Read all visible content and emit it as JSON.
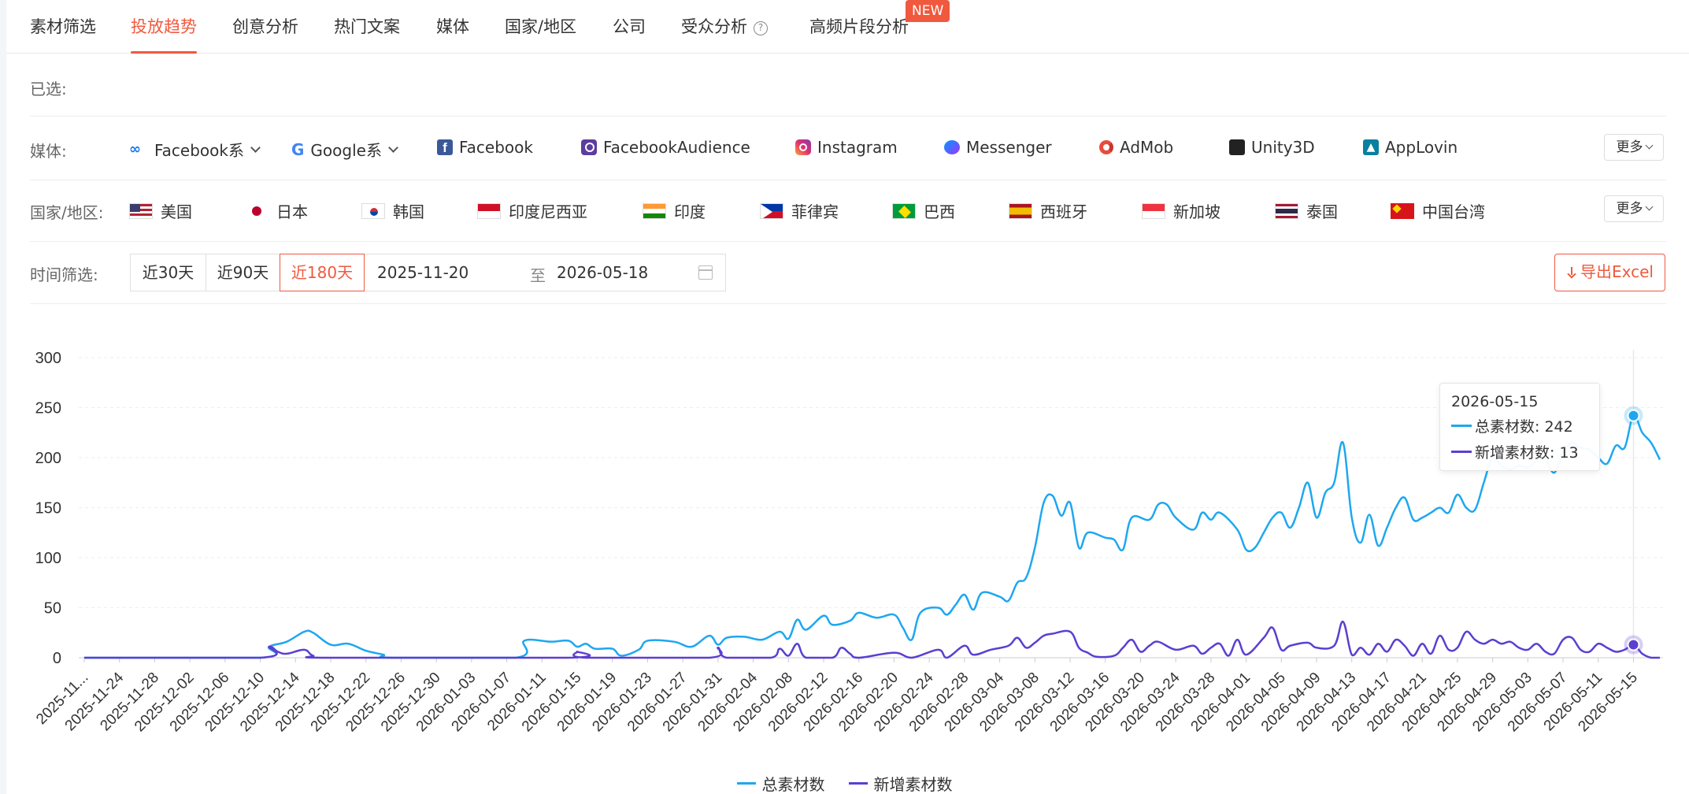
{
  "nav": {
    "tabs": [
      "素材筛选",
      "投放趋势",
      "创意分析",
      "热门文案",
      "媒体",
      "国家/地区",
      "公司",
      "受众分析",
      "高频片段分析"
    ],
    "active_tab": "投放趋势",
    "help_icon": "question-circle-icon",
    "new_badge": "NEW"
  },
  "selected_label": "已选:",
  "media": {
    "label": "媒体:",
    "items": [
      {
        "label": "Facebook系",
        "icon": "meta-icon",
        "dropdown": true
      },
      {
        "label": "Google系",
        "icon": "google-icon",
        "dropdown": true
      },
      {
        "label": "Facebook",
        "icon": "facebook-icon"
      },
      {
        "label": "FacebookAudience",
        "icon": "facebook-audience-icon"
      },
      {
        "label": "Instagram",
        "icon": "instagram-icon"
      },
      {
        "label": "Messenger",
        "icon": "messenger-icon"
      },
      {
        "label": "AdMob",
        "icon": "admob-icon"
      },
      {
        "label": "Unity3D",
        "icon": "unity-icon"
      },
      {
        "label": "AppLovin",
        "icon": "applovin-icon"
      }
    ],
    "more_label": "更多"
  },
  "region": {
    "label": "国家/地区:",
    "items": [
      {
        "label": "美国",
        "icon": "us-flag-icon"
      },
      {
        "label": "日本",
        "icon": "jp-flag-icon"
      },
      {
        "label": "韩国",
        "icon": "kr-flag-icon"
      },
      {
        "label": "印度尼西亚",
        "icon": "id-flag-icon"
      },
      {
        "label": "印度",
        "icon": "in-flag-icon"
      },
      {
        "label": "菲律宾",
        "icon": "ph-flag-icon"
      },
      {
        "label": "巴西",
        "icon": "br-flag-icon"
      },
      {
        "label": "西班牙",
        "icon": "es-flag-icon"
      },
      {
        "label": "新加坡",
        "icon": "sg-flag-icon"
      },
      {
        "label": "泰国",
        "icon": "th-flag-icon"
      },
      {
        "label": "中国台湾",
        "icon": "tw-flag-icon"
      }
    ],
    "more_label": "更多"
  },
  "time": {
    "label": "时间筛选:",
    "presets": [
      "近30天",
      "近90天",
      "近180天"
    ],
    "active_preset": "近180天",
    "start_date": "2025-11-20",
    "separator": "至",
    "end_date": "2026-05-18"
  },
  "export_label": "导出Excel",
  "colors": {
    "accent": "#f0593e",
    "total": "#1ea7f0",
    "new": "#5b3fd1"
  },
  "tooltip": {
    "date": "2026-05-15",
    "rows": [
      "总素材数: 242",
      "新增素材数: 13"
    ]
  },
  "chart_data": {
    "type": "line",
    "ylim": [
      0,
      300
    ],
    "yticks": [
      "0",
      "50",
      "100",
      "150",
      "200",
      "250",
      "300"
    ],
    "xticks": [
      "2025-11...",
      "2025-11-24",
      "2025-11-28",
      "2025-12-02",
      "2025-12-06",
      "2025-12-10",
      "2025-12-14",
      "2025-12-18",
      "2025-12-22",
      "2025-12-26",
      "2025-12-30",
      "2026-01-03",
      "2026-01-07",
      "2026-01-11",
      "2026-01-15",
      "2026-01-19",
      "2026-01-23",
      "2026-01-27",
      "2026-01-31",
      "2026-02-04",
      "2026-02-08",
      "2026-02-12",
      "2026-02-16",
      "2026-02-20",
      "2026-02-24",
      "2026-02-28",
      "2026-03-04",
      "2026-03-08",
      "2026-03-12",
      "2026-03-16",
      "2026-03-20",
      "2026-03-24",
      "2026-03-28",
      "2026-04-01",
      "2026-04-05",
      "2026-04-09",
      "2026-04-13",
      "2026-04-17",
      "2026-04-21",
      "2026-04-25",
      "2026-04-29",
      "2026-05-03",
      "2026-05-07",
      "2026-05-11",
      "2026-05-15"
    ],
    "x_start": "2025-11-20",
    "x_end": "2026-05-18",
    "grid": true,
    "legend_position": "bottom",
    "series": [
      {
        "name": "总素材数",
        "points": [
          [
            "2025-11-20",
            0
          ],
          [
            "2025-12-10",
            0
          ],
          [
            "2025-12-11",
            11
          ],
          [
            "2025-12-13",
            16
          ],
          [
            "2025-12-15",
            26
          ],
          [
            "2025-12-16",
            25
          ],
          [
            "2025-12-18",
            13
          ],
          [
            "2025-12-20",
            14
          ],
          [
            "2025-12-22",
            7
          ],
          [
            "2025-12-24",
            3
          ],
          [
            "2025-12-25",
            0
          ],
          [
            "2026-01-08",
            0
          ],
          [
            "2026-01-09",
            17
          ],
          [
            "2026-01-12",
            16
          ],
          [
            "2026-01-14",
            17
          ],
          [
            "2026-01-15",
            11
          ],
          [
            "2026-01-16",
            14
          ],
          [
            "2026-01-17",
            9
          ],
          [
            "2026-01-19",
            9
          ],
          [
            "2026-01-20",
            2
          ],
          [
            "2026-01-22",
            8
          ],
          [
            "2026-01-23",
            17
          ],
          [
            "2026-01-26",
            16
          ],
          [
            "2026-01-28",
            11
          ],
          [
            "2026-01-30",
            22
          ],
          [
            "2026-01-31",
            13
          ],
          [
            "2026-02-01",
            20
          ],
          [
            "2026-02-03",
            21
          ],
          [
            "2026-02-05",
            18
          ],
          [
            "2026-02-07",
            26
          ],
          [
            "2026-02-08",
            19
          ],
          [
            "2026-02-09",
            38
          ],
          [
            "2026-02-10",
            28
          ],
          [
            "2026-02-12",
            42
          ],
          [
            "2026-02-13",
            33
          ],
          [
            "2026-02-15",
            37
          ],
          [
            "2026-02-16",
            45
          ],
          [
            "2026-02-18",
            40
          ],
          [
            "2026-02-20",
            43
          ],
          [
            "2026-02-21",
            30
          ],
          [
            "2026-02-22",
            18
          ],
          [
            "2026-02-23",
            45
          ],
          [
            "2026-02-25",
            50
          ],
          [
            "2026-02-26",
            43
          ],
          [
            "2026-02-27",
            53
          ],
          [
            "2026-02-28",
            63
          ],
          [
            "2026-03-01",
            48
          ],
          [
            "2026-03-02",
            65
          ],
          [
            "2026-03-04",
            61
          ],
          [
            "2026-03-05",
            57
          ],
          [
            "2026-03-06",
            75
          ],
          [
            "2026-03-07",
            80
          ],
          [
            "2026-03-08",
            110
          ],
          [
            "2026-03-09",
            155
          ],
          [
            "2026-03-10",
            162
          ],
          [
            "2026-03-11",
            142
          ],
          [
            "2026-03-12",
            155
          ],
          [
            "2026-03-13",
            110
          ],
          [
            "2026-03-14",
            125
          ],
          [
            "2026-03-16",
            120
          ],
          [
            "2026-03-17",
            118
          ],
          [
            "2026-03-18",
            108
          ],
          [
            "2026-03-19",
            140
          ],
          [
            "2026-03-21",
            138
          ],
          [
            "2026-03-22",
            153
          ],
          [
            "2026-03-23",
            153
          ],
          [
            "2026-03-24",
            140
          ],
          [
            "2026-03-26",
            128
          ],
          [
            "2026-03-27",
            145
          ],
          [
            "2026-03-28",
            138
          ],
          [
            "2026-03-29",
            145
          ],
          [
            "2026-03-31",
            128
          ],
          [
            "2026-04-01",
            108
          ],
          [
            "2026-04-02",
            110
          ],
          [
            "2026-04-03",
            125
          ],
          [
            "2026-04-04",
            140
          ],
          [
            "2026-04-05",
            145
          ],
          [
            "2026-04-06",
            130
          ],
          [
            "2026-04-07",
            150
          ],
          [
            "2026-04-08",
            175
          ],
          [
            "2026-04-09",
            140
          ],
          [
            "2026-04-10",
            165
          ],
          [
            "2026-04-11",
            175
          ],
          [
            "2026-04-12",
            215
          ],
          [
            "2026-04-13",
            140
          ],
          [
            "2026-04-14",
            115
          ],
          [
            "2026-04-15",
            143
          ],
          [
            "2026-04-16",
            112
          ],
          [
            "2026-04-17",
            130
          ],
          [
            "2026-04-18",
            150
          ],
          [
            "2026-04-19",
            160
          ],
          [
            "2026-04-20",
            138
          ],
          [
            "2026-04-21",
            140
          ],
          [
            "2026-04-22",
            145
          ],
          [
            "2026-04-23",
            150
          ],
          [
            "2026-04-24",
            145
          ],
          [
            "2026-04-25",
            163
          ],
          [
            "2026-04-26",
            150
          ],
          [
            "2026-04-27",
            148
          ],
          [
            "2026-04-28",
            175
          ],
          [
            "2026-04-29",
            200
          ],
          [
            "2026-04-30",
            192
          ],
          [
            "2026-05-01",
            188
          ],
          [
            "2026-05-02",
            192
          ],
          [
            "2026-05-03",
            190
          ],
          [
            "2026-05-04",
            197
          ],
          [
            "2026-05-05",
            198
          ],
          [
            "2026-05-06",
            185
          ],
          [
            "2026-05-07",
            205
          ],
          [
            "2026-05-08",
            215
          ],
          [
            "2026-05-09",
            210
          ],
          [
            "2026-05-10",
            208
          ],
          [
            "2026-05-11",
            200
          ],
          [
            "2026-05-12",
            194
          ],
          [
            "2026-05-13",
            212
          ],
          [
            "2026-05-14",
            210
          ],
          [
            "2026-05-15",
            242
          ],
          [
            "2026-05-16",
            225
          ],
          [
            "2026-05-17",
            215
          ],
          [
            "2026-05-18",
            198
          ]
        ]
      },
      {
        "name": "新增素材数",
        "points": [
          [
            "2025-11-20",
            0
          ],
          [
            "2025-12-10",
            0
          ],
          [
            "2025-12-11",
            11
          ],
          [
            "2025-12-12",
            6
          ],
          [
            "2025-12-13",
            4
          ],
          [
            "2025-12-15",
            8
          ],
          [
            "2025-12-16",
            2
          ],
          [
            "2025-12-18",
            0
          ],
          [
            "2026-01-14",
            0
          ],
          [
            "2026-01-15",
            6
          ],
          [
            "2026-01-16",
            0
          ],
          [
            "2026-01-30",
            0
          ],
          [
            "2026-01-31",
            10
          ],
          [
            "2026-02-01",
            0
          ],
          [
            "2026-02-06",
            0
          ],
          [
            "2026-02-07",
            9
          ],
          [
            "2026-02-08",
            2
          ],
          [
            "2026-02-09",
            14
          ],
          [
            "2026-02-10",
            0
          ],
          [
            "2026-02-13",
            0
          ],
          [
            "2026-02-14",
            10
          ],
          [
            "2026-02-15",
            4
          ],
          [
            "2026-02-16",
            0
          ],
          [
            "2026-02-20",
            5
          ],
          [
            "2026-02-22",
            0
          ],
          [
            "2026-02-25",
            8
          ],
          [
            "2026-02-26",
            0
          ],
          [
            "2026-02-28",
            12
          ],
          [
            "2026-03-01",
            3
          ],
          [
            "2026-03-03",
            8
          ],
          [
            "2026-03-05",
            12
          ],
          [
            "2026-03-06",
            20
          ],
          [
            "2026-03-07",
            10
          ],
          [
            "2026-03-08",
            15
          ],
          [
            "2026-03-09",
            22
          ],
          [
            "2026-03-10",
            24
          ],
          [
            "2026-03-12",
            26
          ],
          [
            "2026-03-13",
            10
          ],
          [
            "2026-03-14",
            5
          ],
          [
            "2026-03-15",
            1
          ],
          [
            "2026-03-17",
            2
          ],
          [
            "2026-03-18",
            10
          ],
          [
            "2026-03-19",
            18
          ],
          [
            "2026-03-20",
            6
          ],
          [
            "2026-03-21",
            12
          ],
          [
            "2026-03-22",
            16
          ],
          [
            "2026-03-24",
            8
          ],
          [
            "2026-03-26",
            12
          ],
          [
            "2026-03-27",
            4
          ],
          [
            "2026-03-28",
            10
          ],
          [
            "2026-03-29",
            14
          ],
          [
            "2026-03-30",
            2
          ],
          [
            "2026-03-31",
            18
          ],
          [
            "2026-04-01",
            3
          ],
          [
            "2026-04-03",
            20
          ],
          [
            "2026-04-04",
            30
          ],
          [
            "2026-04-05",
            8
          ],
          [
            "2026-04-06",
            12
          ],
          [
            "2026-04-08",
            15
          ],
          [
            "2026-04-09",
            10
          ],
          [
            "2026-04-11",
            12
          ],
          [
            "2026-04-12",
            36
          ],
          [
            "2026-04-13",
            3
          ],
          [
            "2026-04-14",
            10
          ],
          [
            "2026-04-15",
            3
          ],
          [
            "2026-04-16",
            14
          ],
          [
            "2026-04-17",
            6
          ],
          [
            "2026-04-18",
            18
          ],
          [
            "2026-04-19",
            12
          ],
          [
            "2026-04-20",
            2
          ],
          [
            "2026-04-21",
            14
          ],
          [
            "2026-04-22",
            4
          ],
          [
            "2026-04-23",
            22
          ],
          [
            "2026-04-24",
            8
          ],
          [
            "2026-04-25",
            10
          ],
          [
            "2026-04-26",
            26
          ],
          [
            "2026-04-27",
            18
          ],
          [
            "2026-04-28",
            14
          ],
          [
            "2026-04-29",
            18
          ],
          [
            "2026-04-30",
            14
          ],
          [
            "2026-05-01",
            16
          ],
          [
            "2026-05-02",
            10
          ],
          [
            "2026-05-03",
            8
          ],
          [
            "2026-05-04",
            14
          ],
          [
            "2026-05-05",
            6
          ],
          [
            "2026-05-06",
            4
          ],
          [
            "2026-05-07",
            18
          ],
          [
            "2026-05-08",
            20
          ],
          [
            "2026-05-09",
            8
          ],
          [
            "2026-05-10",
            6
          ],
          [
            "2026-05-11",
            14
          ],
          [
            "2026-05-12",
            10
          ],
          [
            "2026-05-13",
            6
          ],
          [
            "2026-05-14",
            8
          ],
          [
            "2026-05-15",
            13
          ],
          [
            "2026-05-16",
            4
          ],
          [
            "2026-05-17",
            0
          ],
          [
            "2026-05-18",
            0
          ]
        ]
      }
    ],
    "highlight_date": "2026-05-15"
  }
}
